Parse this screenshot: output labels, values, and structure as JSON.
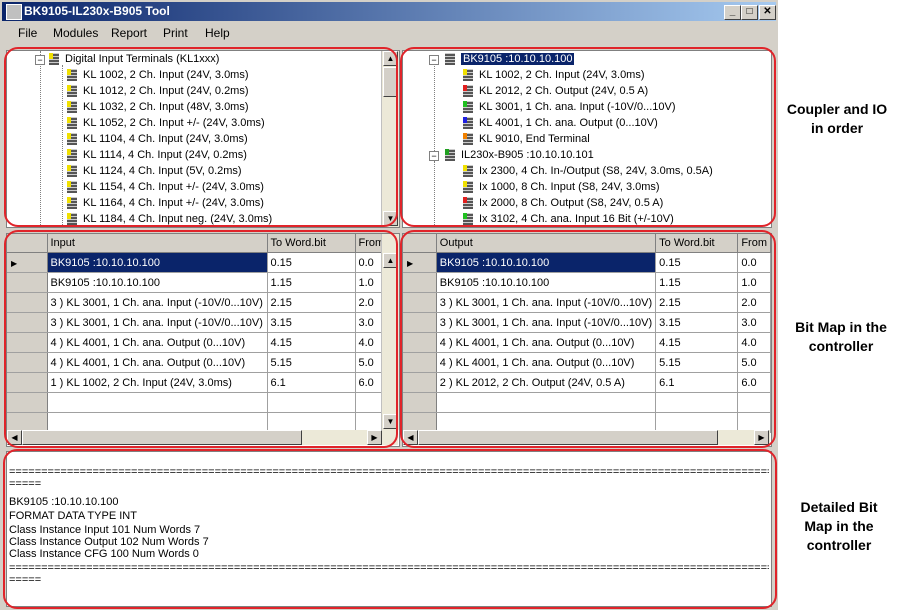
{
  "window": {
    "title": "BK9105-IL230x-B905 Tool",
    "controls": [
      "_",
      "□",
      "✕"
    ]
  },
  "menu": [
    "File",
    "Modules",
    "Report",
    "Print",
    "Help"
  ],
  "left_tree": {
    "group_label": "Digital Input Terminals (KL1xxx)",
    "items": [
      {
        "label": "KL 1002, 2 Ch. Input (24V, 3.0ms)",
        "stripe": "#f0e000"
      },
      {
        "label": "KL 1012, 2 Ch. Input (24V, 0.2ms)",
        "stripe": "#f0e000"
      },
      {
        "label": "KL 1032, 2 Ch. Input (48V, 3.0ms)",
        "stripe": "#f0e000"
      },
      {
        "label": "KL 1052, 2 Ch. Input +/- (24V, 3.0ms)",
        "stripe": "#f0e000"
      },
      {
        "label": "KL 1104, 4 Ch. Input (24V, 3.0ms)",
        "stripe": "#f0e000"
      },
      {
        "label": "KL 1114, 4 Ch. Input (24V, 0.2ms)",
        "stripe": "#f0e000"
      },
      {
        "label": "KL 1124, 4 Ch. Input (5V, 0.2ms)",
        "stripe": "#f0e000"
      },
      {
        "label": "KL 1154, 4 Ch. Input +/- (24V, 3.0ms)",
        "stripe": "#f0e000"
      },
      {
        "label": "KL 1164, 4 Ch. Input +/- (24V, 3.0ms)",
        "stripe": "#f0e000"
      },
      {
        "label": "KL 1184, 4 Ch. Input neg. (24V, 3.0ms)",
        "stripe": "#f0e000"
      }
    ]
  },
  "right_tree": {
    "coupler1": "BK9105 :10.10.10.100",
    "coupler1_items": [
      {
        "label": "KL 1002, 2 Ch. Input (24V, 3.0ms)",
        "stripe": "#f0e000"
      },
      {
        "label": "KL 2012, 2 Ch. Output (24V, 0.5 A)",
        "stripe": "#e02020"
      },
      {
        "label": "KL 3001, 1 Ch. ana. Input (-10V/0...10V)",
        "stripe": "#20c020"
      },
      {
        "label": "KL 4001, 1 Ch. ana. Output (0...10V)",
        "stripe": "#2020e0"
      },
      {
        "label": "KL 9010, End Terminal",
        "stripe": "#f08000"
      }
    ],
    "coupler2": "IL230x-B905 :10.10.10.101",
    "coupler2_items": [
      {
        "label": "Ix 2300, 4 Ch. In-/Output (S8, 24V, 3.0ms, 0.5A)",
        "stripe": "#f0e000"
      },
      {
        "label": "Ix 1000, 8 Ch. Input (S8, 24V, 3.0ms)",
        "stripe": "#f0e000"
      },
      {
        "label": "Ix 2000, 8 Ch. Output (S8, 24V, 0.5 A)",
        "stripe": "#e02020"
      },
      {
        "label": "Ix 3102, 4 Ch. ana. Input 16 Bit (+/-10V)",
        "stripe": "#20c020"
      }
    ]
  },
  "input_grid": {
    "headers": [
      "Input",
      "To Word.bit",
      "From"
    ],
    "rows": [
      [
        "BK9105 :10.10.10.100",
        "0.15",
        "0.0"
      ],
      [
        "BK9105 :10.10.10.100",
        "1.15",
        "1.0"
      ],
      [
        "3  ) KL 3001, 1 Ch. ana. Input (-10V/0...10V)",
        "2.15",
        "2.0"
      ],
      [
        "3  ) KL 3001, 1 Ch. ana. Input (-10V/0...10V)",
        "3.15",
        "3.0"
      ],
      [
        "4  ) KL 4001, 1 Ch. ana. Output (0...10V)",
        "4.15",
        "4.0"
      ],
      [
        "4  ) KL 4001, 1 Ch. ana. Output (0...10V)",
        "5.15",
        "5.0"
      ],
      [
        "1  ) KL 1002, 2 Ch. Input (24V, 3.0ms)",
        "6.1",
        "6.0"
      ],
      [
        "",
        "",
        ""
      ],
      [
        "",
        "",
        ""
      ]
    ]
  },
  "output_grid": {
    "headers": [
      "Output",
      "To Word.bit",
      "From"
    ],
    "rows": [
      [
        "BK9105 :10.10.10.100",
        "0.15",
        "0.0"
      ],
      [
        "BK9105 :10.10.10.100",
        "1.15",
        "1.0"
      ],
      [
        "3  ) KL 3001, 1 Ch. ana. Input (-10V/0...10V)",
        "2.15",
        "2.0"
      ],
      [
        "3  ) KL 3001, 1 Ch. ana. Input (-10V/0...10V)",
        "3.15",
        "3.0"
      ],
      [
        "4  ) KL 4001, 1 Ch. ana. Output (0...10V)",
        "4.15",
        "4.0"
      ],
      [
        "4  ) KL 4001, 1 Ch. ana. Output (0...10V)",
        "5.15",
        "5.0"
      ],
      [
        "2  ) KL 2012, 2 Ch. Output (24V, 0.5 A)",
        "6.1",
        "6.0"
      ],
      [
        "",
        "",
        ""
      ],
      [
        "",
        "",
        ""
      ]
    ]
  },
  "detail": {
    "lines": [
      "=====================================================================================================================================",
      "=====",
      "BK9105 :10.10.10.100",
      "FORMAT DATA TYPE INT",
      "Class Instance Input   101  Num Words 7",
      "Class Instance Output  102  Num Words 7",
      "Class Instance CFG    100  Num Words 0",
      "=====================================================================================================================================",
      "====="
    ]
  },
  "annotations": {
    "coupler": "Coupler and IO in order",
    "bitmap": "Bit Map in the controller",
    "detailed": "Detailed Bit Map in the controller",
    "ring_color": "#e0242a"
  }
}
